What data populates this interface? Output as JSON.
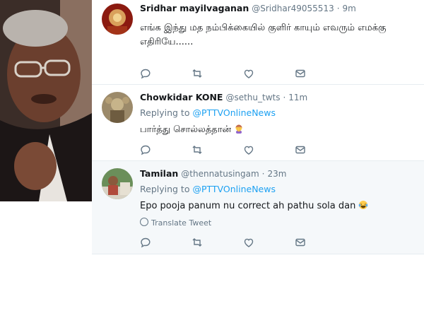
{
  "tweets": [
    {
      "name": "Sridhar mayilvaganan",
      "handle": "@Sridhar49055513",
      "time": "9m",
      "text": "எங்க இந்து மத நம்பிக்கையில் குளிர் காயும் எவரும் எமக்கு எதிரியே......"
    },
    {
      "name": "Chowkidar KONE",
      "handle": "@sethu_twts",
      "time": "11m",
      "replying_label": "Replying to",
      "replying_to": "@PTTVOnlineNews",
      "text": "பார்த்து சொல்லத்தான்"
    },
    {
      "name": "Tamilan",
      "handle": "@thennatusingam",
      "time": "23m",
      "replying_label": "Replying to",
      "replying_to": "@PTTVOnlineNews",
      "text": "Epo pooja panum nu correct ah pathu sola dan",
      "translate": "Translate Tweet"
    }
  ],
  "separator": "·",
  "icons": [
    "reply-icon",
    "retweet-icon",
    "like-icon",
    "direct-message-icon",
    "globe-icon",
    "woman-facepalming-emoji",
    "laughing-tears-emoji"
  ],
  "colors": {
    "link": "#1da1f2",
    "muted": "#657786",
    "text": "#14171a",
    "border": "#e6ecf0",
    "highlight_bg": "#f5f8fa"
  }
}
